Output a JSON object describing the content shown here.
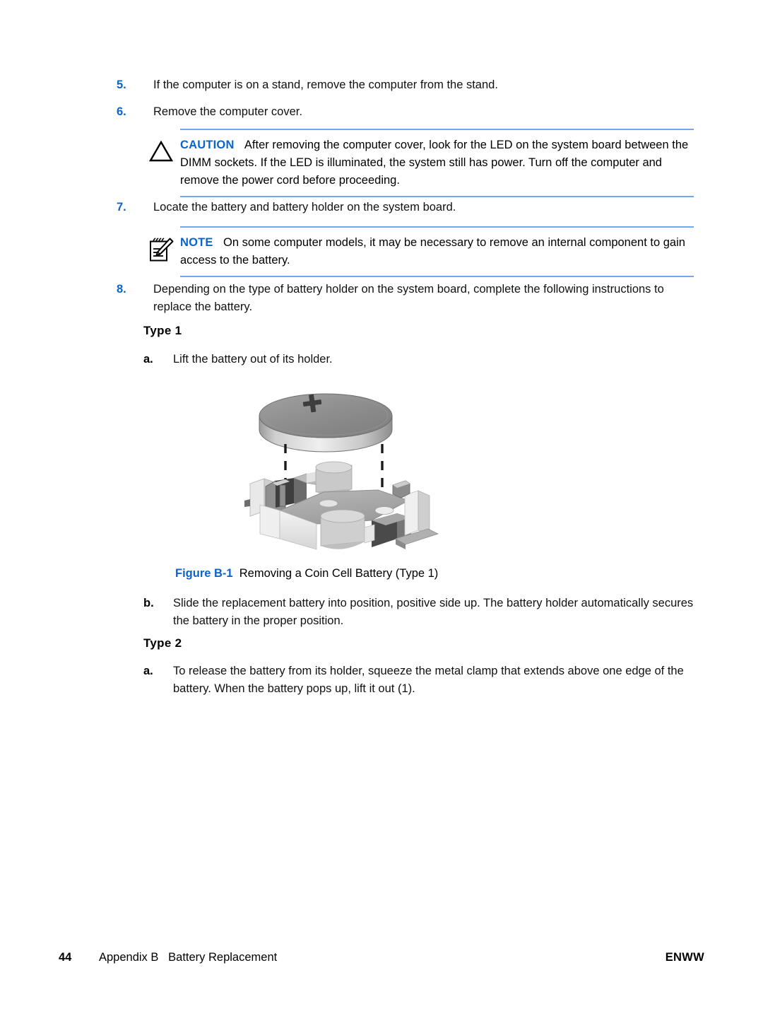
{
  "document": {
    "steps": [
      {
        "marker": "5.",
        "text": "If the computer is on a stand, remove the computer from the stand."
      },
      {
        "marker": "6.",
        "text": "Remove the computer cover."
      },
      {
        "marker": "7.",
        "text": "Locate the battery and battery holder on the system board."
      },
      {
        "marker": "8.",
        "text": "Depending on the type of battery holder on the system board, complete the following instructions to replace the battery."
      }
    ],
    "caution": {
      "keyword": "CAUTION",
      "icon": "warning-triangle-icon",
      "text": "After removing the computer cover, look for the LED on the system board between the DIMM sockets. If the LED is illuminated, the system still has power. Turn off the computer and remove the power cord before proceeding."
    },
    "note": {
      "keyword": "NOTE",
      "icon": "notepad-pencil-icon",
      "text": "On some computer models, it may be necessary to remove an internal component to gain access to the battery."
    },
    "type1": {
      "heading": "Type 1",
      "step_a_marker": "a.",
      "step_a_text": "Lift the battery out of its holder.",
      "step_b_marker": "b.",
      "step_b_text": "Slide the replacement battery into position, positive side up. The battery holder automatically secures the battery in the proper position."
    },
    "type2": {
      "heading": "Type 2",
      "step_a_marker": "a.",
      "step_a_text": "To release the battery from its holder, squeeze the metal clamp that extends above one edge of the battery. When the battery pops up, lift it out (1)."
    },
    "figure": {
      "label": "Figure B-1",
      "caption": "Removing a Coin Cell Battery (Type 1)",
      "alt": "coin-cell-battery-and-holder-illustration"
    },
    "footer": {
      "page_number": "44",
      "crumb": "Appendix B   Battery Replacement",
      "right": "ENWW"
    },
    "colors": {
      "accent_blue": "#0B63CE",
      "rule_blue": "#6FA8F0",
      "text_black": "#111111"
    }
  }
}
